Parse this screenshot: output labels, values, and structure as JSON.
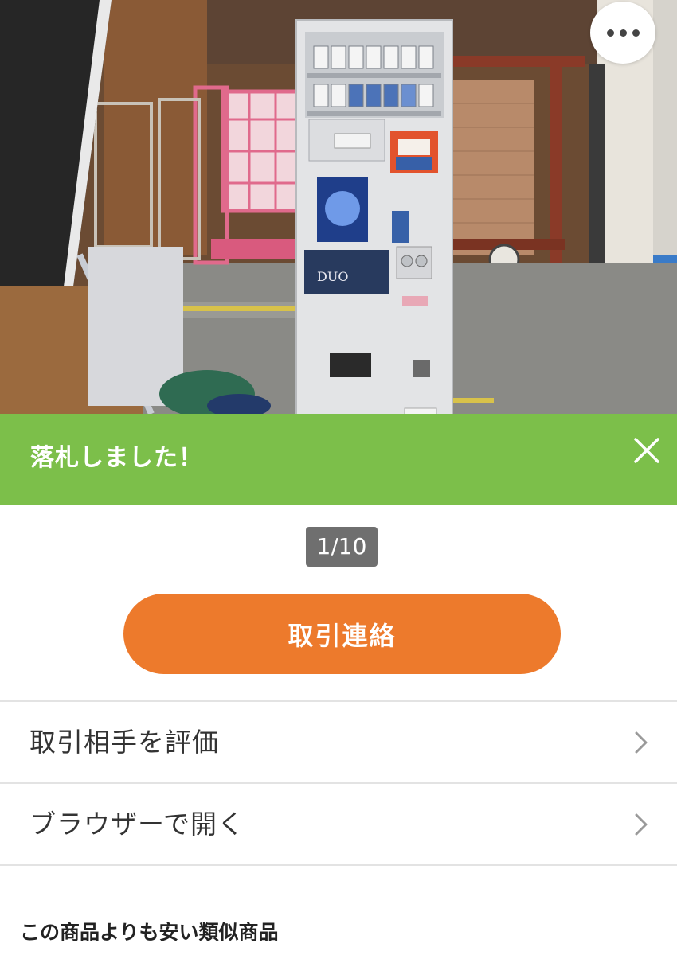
{
  "banner": {
    "message": "落札しました！",
    "color": "#7cbf4a"
  },
  "image_counter": "1/10",
  "contact_button": {
    "label": "取引連絡",
    "color": "#ed7a2c"
  },
  "menu_items": [
    {
      "label": "取引相手を評価",
      "icon": "chevron-right-icon"
    },
    {
      "label": "ブラウザーで開く",
      "icon": "chevron-right-icon"
    }
  ],
  "similar_section": {
    "title": "この商品よりも安い類似商品"
  },
  "icons": {
    "more": "more-horizontal-icon",
    "close": "close-icon"
  },
  "photo": {
    "ad_panel_text": "DUO"
  }
}
